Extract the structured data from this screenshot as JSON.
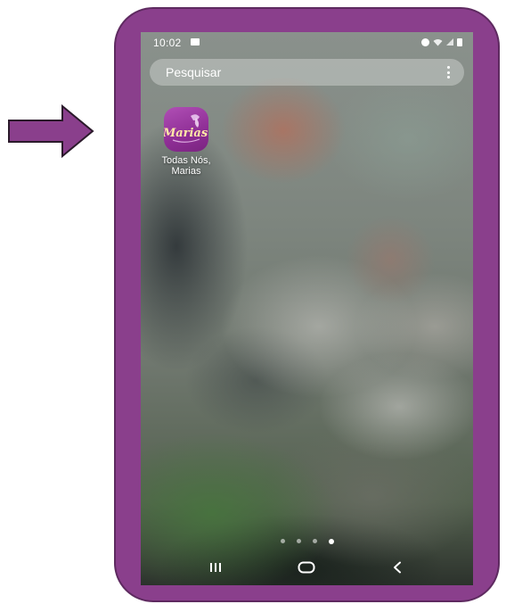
{
  "status_bar": {
    "time": "10:02"
  },
  "search": {
    "label": "Pesquisar"
  },
  "apps": [
    {
      "label_line1": "Todas Nós,",
      "label_line2": "Marias",
      "icon_text": "Marias"
    }
  ],
  "home": {
    "page_count": 4,
    "active_page": 4
  },
  "colors": {
    "frame": "#8a3f8c",
    "arrow": "#8a3f8c",
    "app_icon": "#9a3aa0"
  },
  "icons": {
    "arrow": "right-arrow-icon",
    "search_menu": "more-vertical-icon",
    "nav_recents": "recents-icon",
    "nav_home": "home-icon",
    "nav_back": "back-icon"
  }
}
